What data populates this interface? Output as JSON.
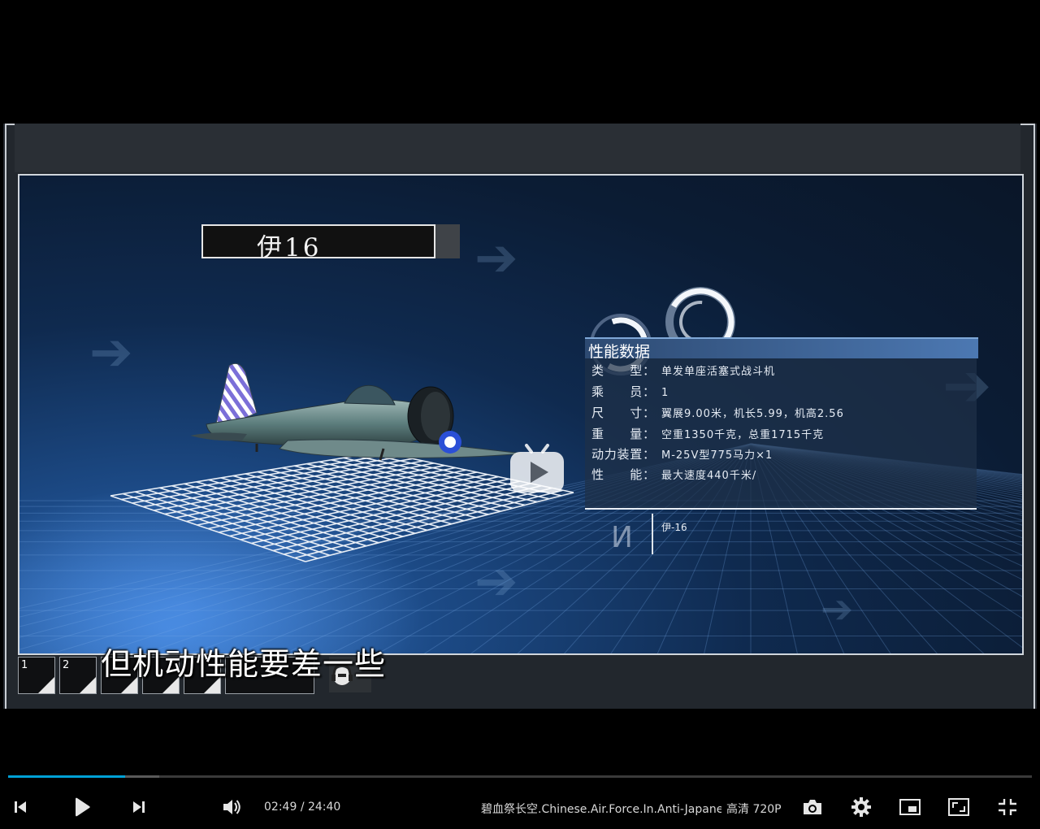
{
  "video": {
    "title_card": "伊16",
    "info_header": "性能数据",
    "specs": [
      {
        "label": "类　　型：",
        "value": "单发单座活塞式战斗机"
      },
      {
        "label": "乘　　员：",
        "value": "1"
      },
      {
        "label": "尺　　寸：",
        "value": "翼展9.00米，机长5.99，机高2.56"
      },
      {
        "label": "重　　量：",
        "value": "空重1350千克，总重1715千克"
      },
      {
        "label": "动力装置：",
        "value": "M-25V型775马力×1"
      },
      {
        "label": "性　　能：",
        "value": "最大速度440千米/"
      }
    ],
    "brand_glyph": "И",
    "brand_name": "伊-16",
    "subtitle": "但机动性能要差一些",
    "thumbnails": [
      "1",
      "2",
      "",
      "",
      ""
    ]
  },
  "player": {
    "current_time": "02:49",
    "separator": "/",
    "duration": "24:40",
    "progress_fraction": 0.114,
    "buffer_fraction": 0.148,
    "video_title": "碧血祭长空.Chinese.Air.Force.In.Anti-Japanese...",
    "quality_label": "高清 720P",
    "accent_color": "#00a1d6",
    "icons": [
      "prev-icon",
      "play-icon",
      "next-icon",
      "volume-icon",
      "screenshot-icon",
      "settings-icon",
      "pip-icon",
      "web-fullscreen-icon",
      "fullscreen-exit-icon"
    ]
  }
}
